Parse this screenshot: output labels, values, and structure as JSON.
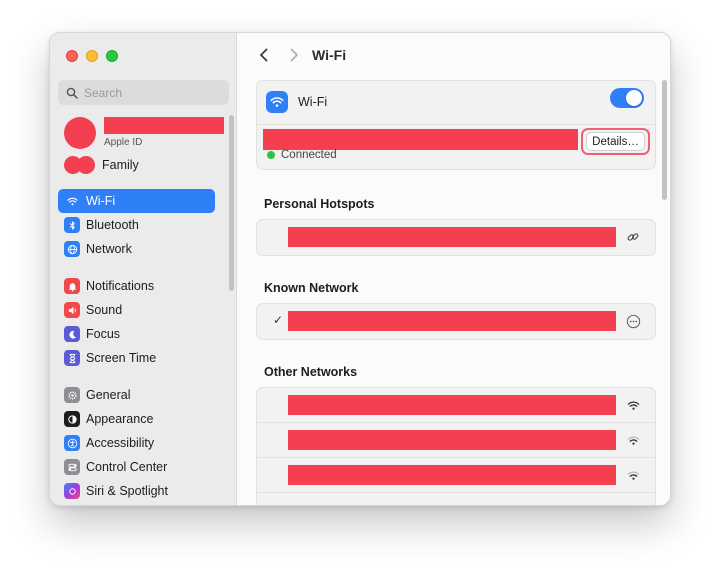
{
  "window": {
    "title": "Wi-Fi"
  },
  "sidebar": {
    "search_placeholder": "Search",
    "profile": {
      "subtitle": "Apple ID"
    },
    "family_label": "Family",
    "items": [
      {
        "label": "Wi-Fi",
        "icon": "wifi-icon",
        "color": "#2f7ff6",
        "active": true
      },
      {
        "label": "Bluetooth",
        "icon": "bluetooth-icon",
        "color": "#2f7ff6"
      },
      {
        "label": "Network",
        "icon": "globe-icon",
        "color": "#2f7ff6"
      },
      {
        "label": "Notifications",
        "icon": "bell-icon",
        "color": "#f0494c"
      },
      {
        "label": "Sound",
        "icon": "speaker-icon",
        "color": "#f0494c"
      },
      {
        "label": "Focus",
        "icon": "moon-icon",
        "color": "#5b5bd6"
      },
      {
        "label": "Screen Time",
        "icon": "hourglass-icon",
        "color": "#5b5bd6"
      },
      {
        "label": "General",
        "icon": "gear-icon",
        "color": "#8e8e93"
      },
      {
        "label": "Appearance",
        "icon": "appearance-icon",
        "color": "#1d1d1f"
      },
      {
        "label": "Accessibility",
        "icon": "accessibility-icon",
        "color": "#2f7ff6"
      },
      {
        "label": "Control Center",
        "icon": "control-center-icon",
        "color": "#8e8e93"
      },
      {
        "label": "Siri & Spotlight",
        "icon": "siri-icon",
        "color": "#7a3bd8"
      }
    ]
  },
  "main": {
    "wifi_label": "Wi-Fi",
    "wifi_enabled": true,
    "status": "Connected",
    "details_button": "Details…",
    "sections": {
      "hotspots": "Personal Hotspots",
      "known": "Known Network",
      "other": "Other Networks"
    }
  },
  "colors": {
    "accent": "#2f7ff6",
    "redaction": "#f43f51",
    "status_green": "#2dc53f"
  }
}
